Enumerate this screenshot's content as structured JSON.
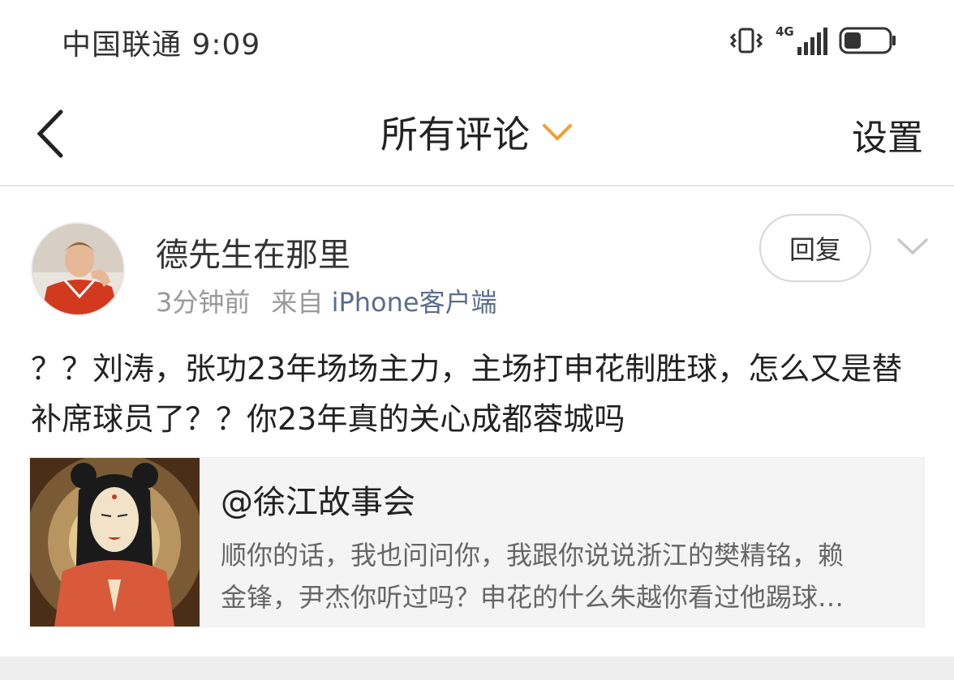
{
  "status_bar": {
    "carrier": "中国联通",
    "time": "9:09",
    "network": "4G",
    "icons": [
      "vibrate-icon",
      "signal-icon",
      "battery-icon"
    ]
  },
  "nav": {
    "title": "所有评论",
    "settings_label": "设置",
    "accent_color": "#f0a030"
  },
  "comment": {
    "username": "德先生在那里",
    "time_ago": "3分钟前",
    "from_prefix": "来自",
    "source": "iPhone客户端",
    "reply_label": "回复",
    "text": "？？刘涛，张功23年场场主力，主场打申花制胜球，怎么又是替补席球员了？？你23年真的关心成都蓉城吗",
    "quote": {
      "author": "@徐江故事会",
      "text": "顺你的话，我也问问你，我跟你说说浙江的樊精铭，赖\n金锋，尹杰你听过吗？申花的什么朱越你看过他踢球…"
    }
  }
}
